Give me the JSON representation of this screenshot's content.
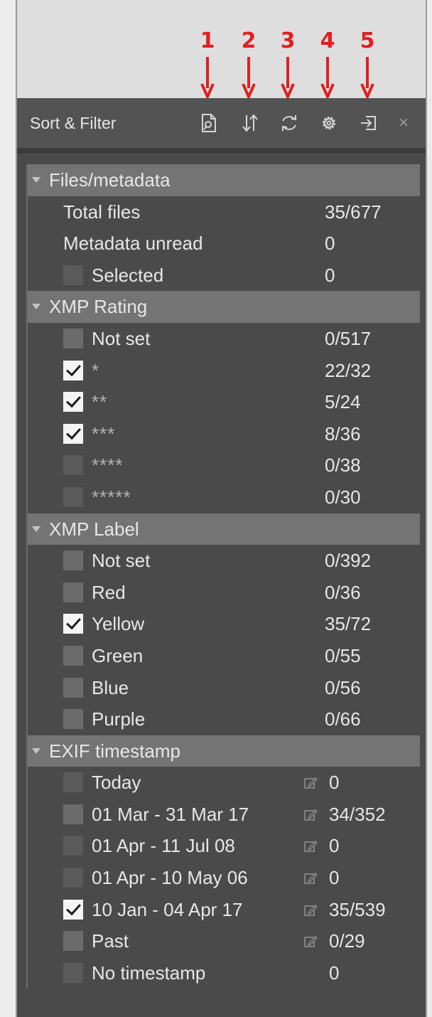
{
  "annotations": [
    "1",
    "2",
    "3",
    "4",
    "5"
  ],
  "panel": {
    "title": "Sort & Filter",
    "toolbar_icons": [
      "search-file-icon",
      "sort-icon",
      "refresh-icon",
      "settings-icon",
      "dock-icon"
    ],
    "close_label": "×"
  },
  "sections": {
    "files": {
      "title": "Files/metadata",
      "total_files_label": "Total files",
      "total_files_count": "35/677",
      "metadata_unread_label": "Metadata unread",
      "metadata_unread_count": "0",
      "selected_label": "Selected",
      "selected_count": "0"
    },
    "rating": {
      "title": "XMP Rating",
      "items": [
        {
          "label": "Not set",
          "count": "0/517",
          "checked": false
        },
        {
          "label": "*",
          "count": "22/32",
          "checked": true
        },
        {
          "label": "**",
          "count": "5/24",
          "checked": true
        },
        {
          "label": "***",
          "count": "8/36",
          "checked": true
        },
        {
          "label": "****",
          "count": "0/38",
          "checked": false
        },
        {
          "label": "*****",
          "count": "0/30",
          "checked": false
        }
      ]
    },
    "label": {
      "title": "XMP Label",
      "items": [
        {
          "label": "Not set",
          "count": "0/392",
          "checked": false
        },
        {
          "label": "Red",
          "count": "0/36",
          "checked": false
        },
        {
          "label": "Yellow",
          "count": "35/72",
          "checked": true
        },
        {
          "label": "Green",
          "count": "0/55",
          "checked": false
        },
        {
          "label": "Blue",
          "count": "0/56",
          "checked": false
        },
        {
          "label": "Purple",
          "count": "0/66",
          "checked": false
        }
      ]
    },
    "timestamp": {
      "title": "EXIF timestamp",
      "items": [
        {
          "label": "Today",
          "count": "0",
          "checked": false
        },
        {
          "label": "01 Mar - 31 Mar 17",
          "count": "34/352",
          "checked": false
        },
        {
          "label": "01 Apr - 11 Jul 08",
          "count": "0",
          "checked": false
        },
        {
          "label": "01 Apr - 10 May 06",
          "count": "0",
          "checked": false
        },
        {
          "label": "10 Jan - 04 Apr 17",
          "count": "35/539",
          "checked": true
        },
        {
          "label": "Past",
          "count": "0/29",
          "checked": false
        },
        {
          "label": "No timestamp",
          "count": "0",
          "checked": false
        }
      ]
    }
  },
  "colors": {
    "annotation": "#e02020",
    "panel_bg": "#4a4a4a",
    "header_bg": "#747474"
  }
}
